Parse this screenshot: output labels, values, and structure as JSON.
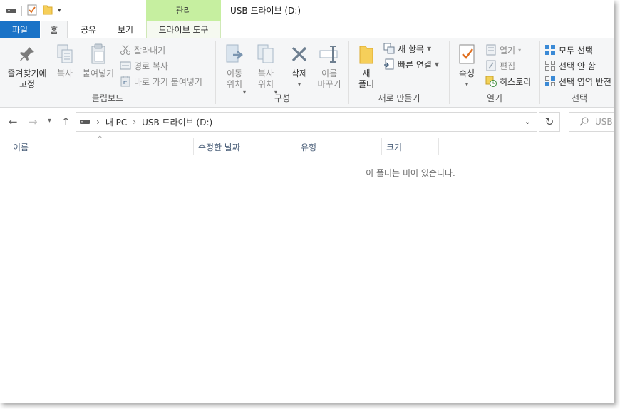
{
  "window": {
    "title": "USB 드라이브 (D:)",
    "context_tab_header": "관리"
  },
  "tabs": {
    "file": "파일",
    "home": "홈",
    "share": "공유",
    "view": "보기",
    "drive_tools": "드라이브 도구"
  },
  "ribbon": {
    "clipboard": {
      "label": "클립보드",
      "pin": "즐겨찾기에\n고정",
      "copy": "복사",
      "paste": "붙여넣기",
      "cut": "잘라내기",
      "copy_path": "경로 복사",
      "paste_shortcut": "바로 가기 붙여넣기"
    },
    "organize": {
      "label": "구성",
      "move_to": "이동\n위치",
      "copy_to": "복사\n위치",
      "delete": "삭제",
      "rename": "이름\n바꾸기"
    },
    "new": {
      "label": "새로 만들기",
      "new_folder": "새\n폴더",
      "new_item": "새 항목",
      "easy_access": "빠른 연결"
    },
    "open": {
      "label": "열기",
      "properties": "속성",
      "open": "열기",
      "edit": "편집",
      "history": "히스토리"
    },
    "select": {
      "label": "선택",
      "select_all": "모두 선택",
      "select_none": "선택 안 함",
      "invert_selection": "선택 영역 반전"
    }
  },
  "address": {
    "crumbs": [
      "내 PC",
      "USB 드라이브 (D:)"
    ],
    "search_placeholder": "USB"
  },
  "columns": [
    "이름",
    "수정한 날짜",
    "유형",
    "크기"
  ],
  "empty_message": "이 폴더는 비어 있습니다.",
  "colors": {
    "file_tab": "#1a73c7",
    "context_tab": "#c6efa0",
    "accent_orange": "#e07020"
  }
}
